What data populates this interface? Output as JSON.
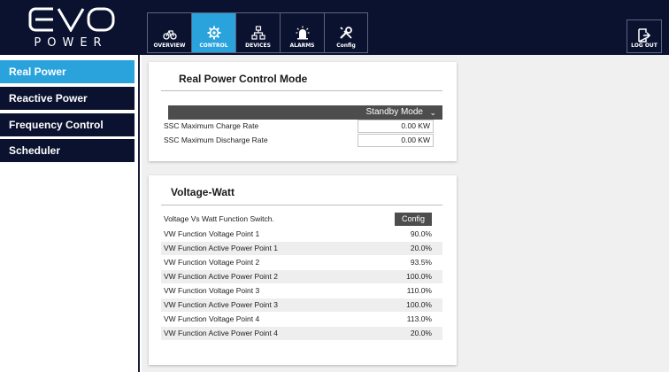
{
  "brand": {
    "logo_top": "EVO",
    "logo_word": "POWER"
  },
  "nav": [
    {
      "label": "OVERVIEW",
      "icon": "bicycle-icon",
      "active": false
    },
    {
      "label": "CONTROL",
      "icon": "gear-icon",
      "active": true
    },
    {
      "label": "DEVICES",
      "icon": "network-icon",
      "active": false
    },
    {
      "label": "ALARMS",
      "icon": "siren-icon",
      "active": false
    },
    {
      "label": "Config",
      "icon": "wrench-screwdriver-icon",
      "active": false
    }
  ],
  "logout": {
    "label": "LOG OUT",
    "icon": "logout-icon"
  },
  "sidebar": {
    "items": [
      {
        "label": "Real Power",
        "active": true
      },
      {
        "label": "Reactive Power",
        "active": false
      },
      {
        "label": "Frequency Control",
        "active": false
      },
      {
        "label": "Scheduler",
        "active": false
      }
    ]
  },
  "real_power": {
    "title": "Real Power Control Mode",
    "mode_value": "Standby Mode",
    "rows": [
      {
        "label": "SSC Maximum Charge Rate",
        "value": "0.00 KW"
      },
      {
        "label": "SSC Maximum Discharge Rate",
        "value": "0.00 KW"
      }
    ]
  },
  "voltage_watt": {
    "title": "Voltage-Watt",
    "switch_label": "Voltage Vs Watt Function Switch.",
    "switch_button": "Config",
    "rows": [
      {
        "label": "VW Function Voltage Point 1",
        "value": "90.0%"
      },
      {
        "label": "VW Function Active Power Point 1",
        "value": "20.0%"
      },
      {
        "label": "VW Function Voltage Point 2",
        "value": "93.5%"
      },
      {
        "label": "VW Function Active Power Point 2",
        "value": "100.0%"
      },
      {
        "label": "VW Function Voltage Point 3",
        "value": "110.0%"
      },
      {
        "label": "VW Function Active Power Point 3",
        "value": "100.0%"
      },
      {
        "label": "VW Function Voltage Point 4",
        "value": "113.0%"
      },
      {
        "label": "VW Function Active Power Point 4",
        "value": "20.0%"
      }
    ]
  },
  "colors": {
    "nav_bg": "#0b1230",
    "accent": "#2aa3dd",
    "dark_bar": "#4d4d4d"
  }
}
